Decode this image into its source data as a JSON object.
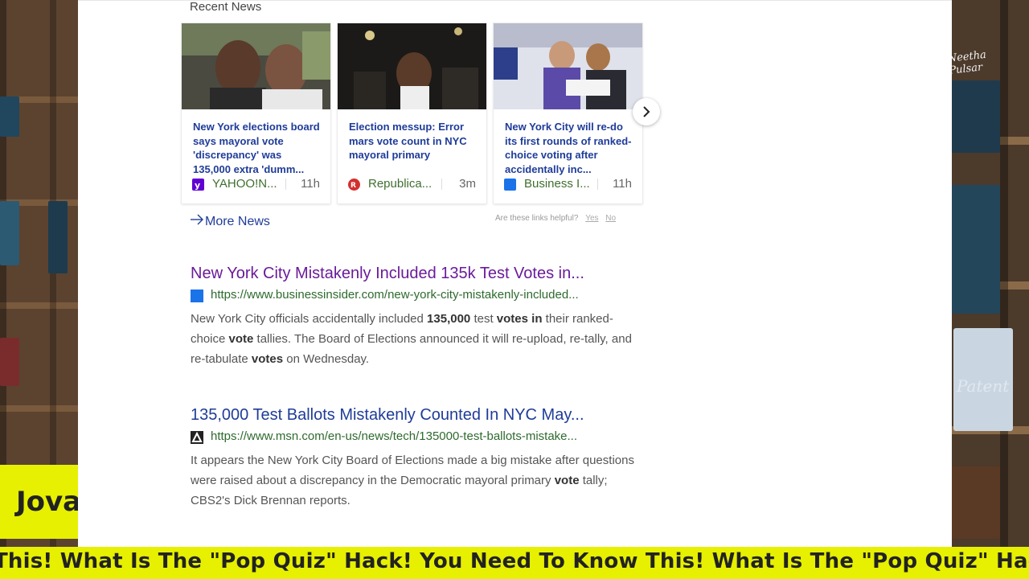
{
  "overlay": {
    "name_badge": "Jova",
    "ticker": "This! What Is The \"Pop Quiz\" Hack! You Need To Know This! What Is The \"Pop Quiz\" Hack! You Need To Know This!",
    "signature": "Neetha Pulsar",
    "patent_text": "Patent"
  },
  "news": {
    "section_title": "Recent News",
    "cards": [
      {
        "headline": "New York elections board says mayoral vote 'discrepancy' was 135,000 extra 'dumm...",
        "source": "YAHOO!N...",
        "age": "11h",
        "source_icon": "yahoo-icon",
        "icon_color": "#6001d2"
      },
      {
        "headline": "Election messup: Error mars vote count in NYC mayoral primary",
        "source": "Republica...",
        "age": "3m",
        "source_icon": "republica-icon",
        "icon_color": "#d32f2f"
      },
      {
        "headline": "New York City will re-do its first rounds of ranked-choice voting after accidentally inc...",
        "source": "Business I...",
        "age": "11h",
        "source_icon": "business-insider-icon",
        "icon_color": "#1a73e8"
      }
    ],
    "more_news": "More News",
    "helpful_prompt": "Are these links helpful?",
    "yes": "Yes",
    "no": "No"
  },
  "results": [
    {
      "title": "New York City Mistakenly Included 135k Test Votes in...",
      "url": "https://www.businessinsider.com/new-york-city-mistakenly-included...",
      "snippet_parts": [
        {
          "t": "New York City officials accidentally included "
        },
        {
          "t": "135,000",
          "b": true
        },
        {
          "t": " test "
        },
        {
          "t": "votes in",
          "b": true
        },
        {
          "t": " their ranked-choice "
        },
        {
          "t": "vote",
          "b": true
        },
        {
          "t": " tallies. The Board of Elections announced it will re-upload, re-tally, and re-tabulate "
        },
        {
          "t": "votes",
          "b": true
        },
        {
          "t": " on Wednesday."
        }
      ]
    },
    {
      "title": "135,000 Test Ballots Mistakenly Counted In NYC May...",
      "url": "https://www.msn.com/en-us/news/tech/135000-test-ballots-mistake...",
      "snippet_parts": [
        {
          "t": "It appears the New York City Board of Elections made a big mistake after questions were raised about a discrepancy in the Democratic mayoral primary "
        },
        {
          "t": "vote",
          "b": true
        },
        {
          "t": " tally; CBS2's Dick Brennan reports."
        }
      ]
    }
  ],
  "colors": {
    "ticker_bg": "#e6f000",
    "link": "#1f3c99",
    "visited_link": "#6a1b9a",
    "url_green": "#2e6a2e"
  }
}
